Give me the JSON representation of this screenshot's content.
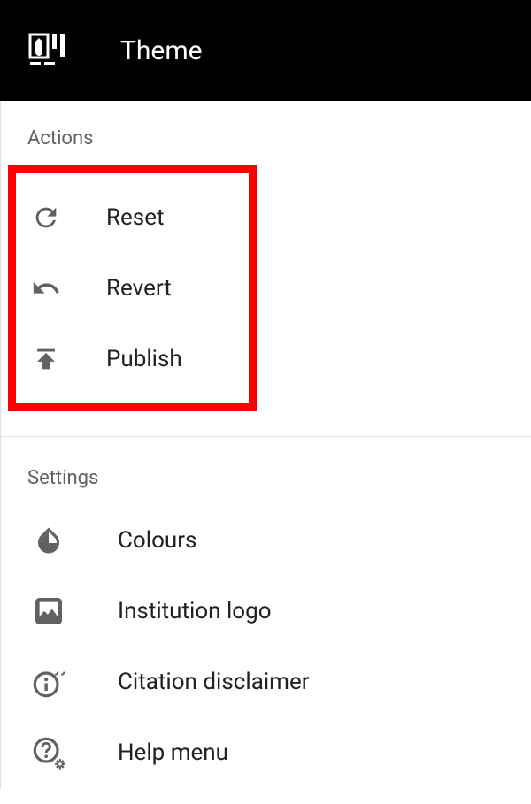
{
  "header": {
    "title": "Theme"
  },
  "sections": {
    "actions": {
      "heading": "Actions",
      "items": [
        {
          "label": "Reset"
        },
        {
          "label": "Revert"
        },
        {
          "label": "Publish"
        }
      ]
    },
    "settings": {
      "heading": "Settings",
      "items": [
        {
          "label": "Colours"
        },
        {
          "label": "Institution logo"
        },
        {
          "label": "Citation disclaimer"
        },
        {
          "label": "Help menu"
        }
      ]
    }
  }
}
